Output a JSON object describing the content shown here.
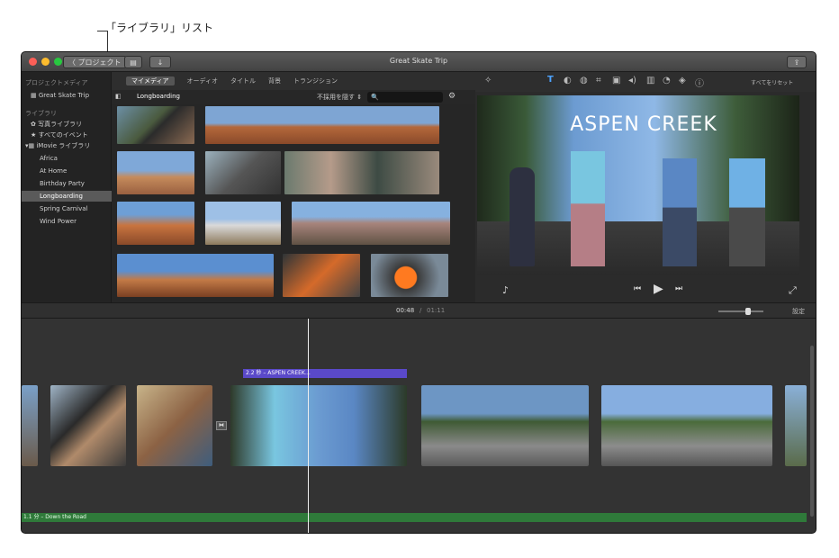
{
  "callout": {
    "label": "「ライブラリ」リスト"
  },
  "window": {
    "title": "Great Skate Trip",
    "back_button": "〈 プロジェクト",
    "share_icon": "share-icon"
  },
  "browser_tabs": [
    "マイメディア",
    "オーディオ",
    "タイトル",
    "背景",
    "トランジション"
  ],
  "library_bar": {
    "event_name": "Longboarding",
    "filter_label": "不採用を隠す ⇕",
    "search_placeholder": "🔍"
  },
  "sidebar": {
    "project_media_head": "プロジェクトメディア",
    "project_item": "Great Skate Trip",
    "libraries_head": "ライブラリ",
    "items": [
      "写真ライブラリ",
      "すべてのイベント",
      "iMovie ライブラリ",
      "Africa",
      "At Home",
      "Birthday Party",
      "Longboarding",
      "Spring Carnival",
      "Wind Power"
    ],
    "selected_index": 6
  },
  "viewer": {
    "overlay_title": "ASPEN CREEK",
    "reset_label": "すべてをリセット"
  },
  "timebar": {
    "current": "00:48",
    "separator": "/",
    "total": "01:11",
    "settings_label": "設定"
  },
  "timeline": {
    "title_clip_label": "2.2 秒 – ASPEN CREEK…",
    "audio_clip_label": "1.1 分 – Down the Road"
  },
  "colors": {
    "title_track": "#5a49c9",
    "audio_track": "#2f7a3a",
    "selected_row": "#5a5a5a"
  }
}
